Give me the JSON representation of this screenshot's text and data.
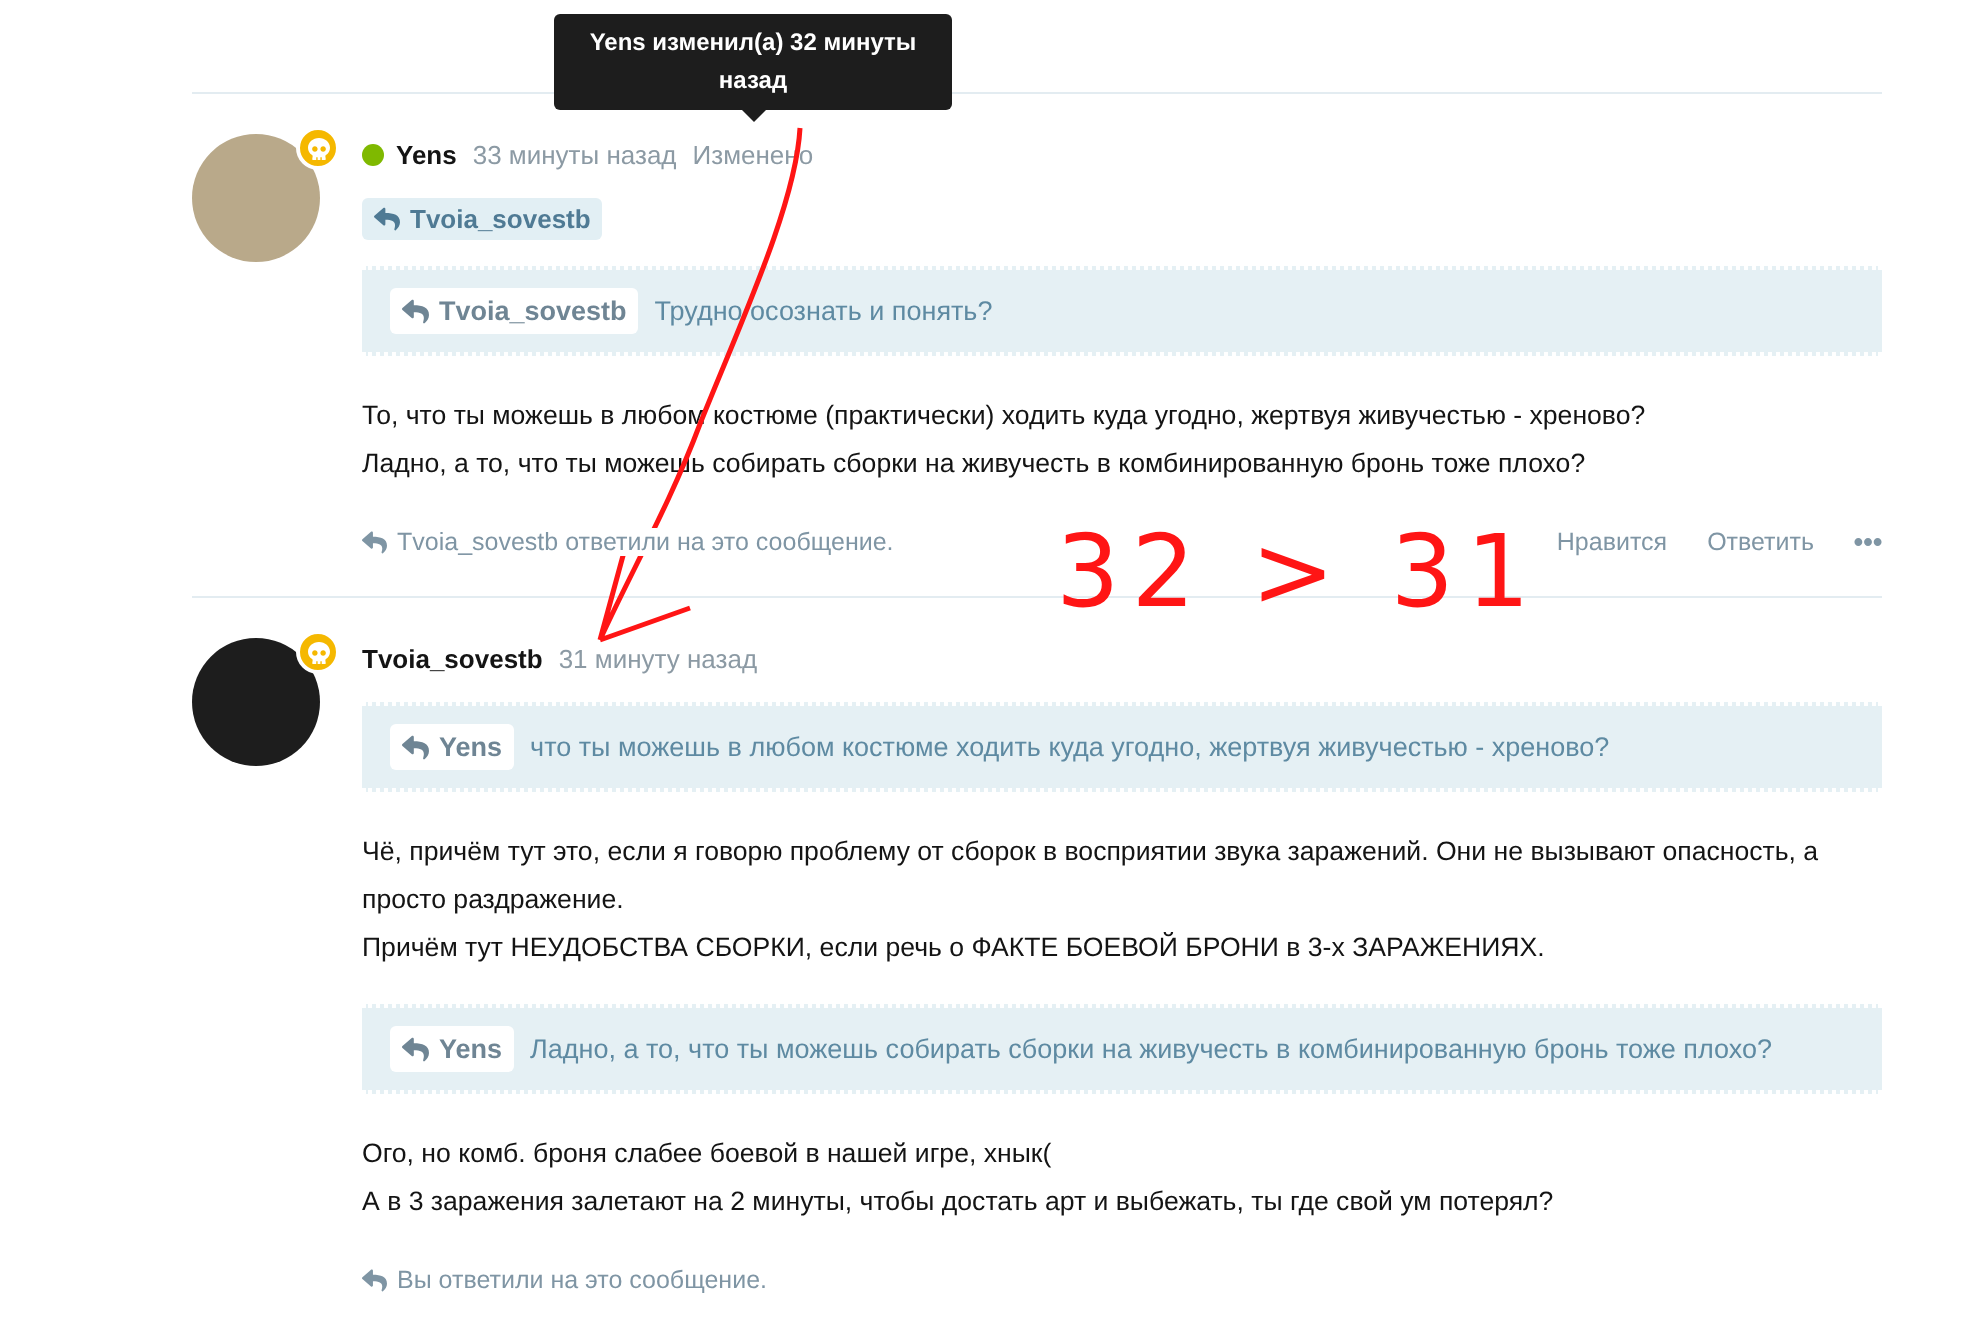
{
  "posts": [
    {
      "author": "Yens",
      "online": true,
      "time": "33 минуты назад",
      "edited": "Изменено",
      "tooltip": "Yens изменил(а) 32 минуты назад",
      "reply_to": "Tvoia_sovestb",
      "blocks": [
        {
          "kind": "quote",
          "author": "Tvoia_sovestb",
          "text": "Трудно осознать и понять?"
        },
        {
          "kind": "text",
          "lines": [
            "То, что ты можешь в любом костюме (практически) ходить куда угодно, жертвуя живучестью - хреново?",
            "Ладно, а то, что ты можешь собирать сборки на живучесть в комбинированную бронь тоже плохо?"
          ]
        }
      ],
      "reply_note": "Tvoia_sovestb ответили на это сообщение.",
      "actions": [
        "Нравится",
        "Ответить"
      ]
    },
    {
      "author": "Tvoia_sovestb",
      "online": false,
      "time": "31 минуту назад",
      "blocks": [
        {
          "kind": "quote",
          "author": "Yens",
          "text": "что ты можешь в любом костюме ходить куда угодно, жертвуя живучестью - хреново?"
        },
        {
          "kind": "text",
          "lines": [
            "Чё, причём тут это, если я говорю проблему от сборок в восприятии звука заражений. Они не вызывают опасность, а просто раздражение.",
            "Причём тут НЕУДОБСТВА СБОРКИ, если речь о ФАКТЕ БОЕВОЙ БРОНИ в 3-х ЗАРАЖЕНИЯХ."
          ]
        },
        {
          "kind": "quote",
          "author": "Yens",
          "text": "Ладно, а то, что ты можешь собирать сборки на живучесть в комбинированную бронь тоже плохо?"
        },
        {
          "kind": "text",
          "lines": [
            "Ого, но комб. броня слабее боевой в нашей игре, хнык(",
            "А в 3 заражения залетают на 2 минуты, чтобы достать арт и выбежать, ты где свой ум потерял?"
          ]
        }
      ],
      "reply_note": "Вы ответили на это сообщение."
    }
  ],
  "annotation": {
    "text": "32 > 31"
  }
}
